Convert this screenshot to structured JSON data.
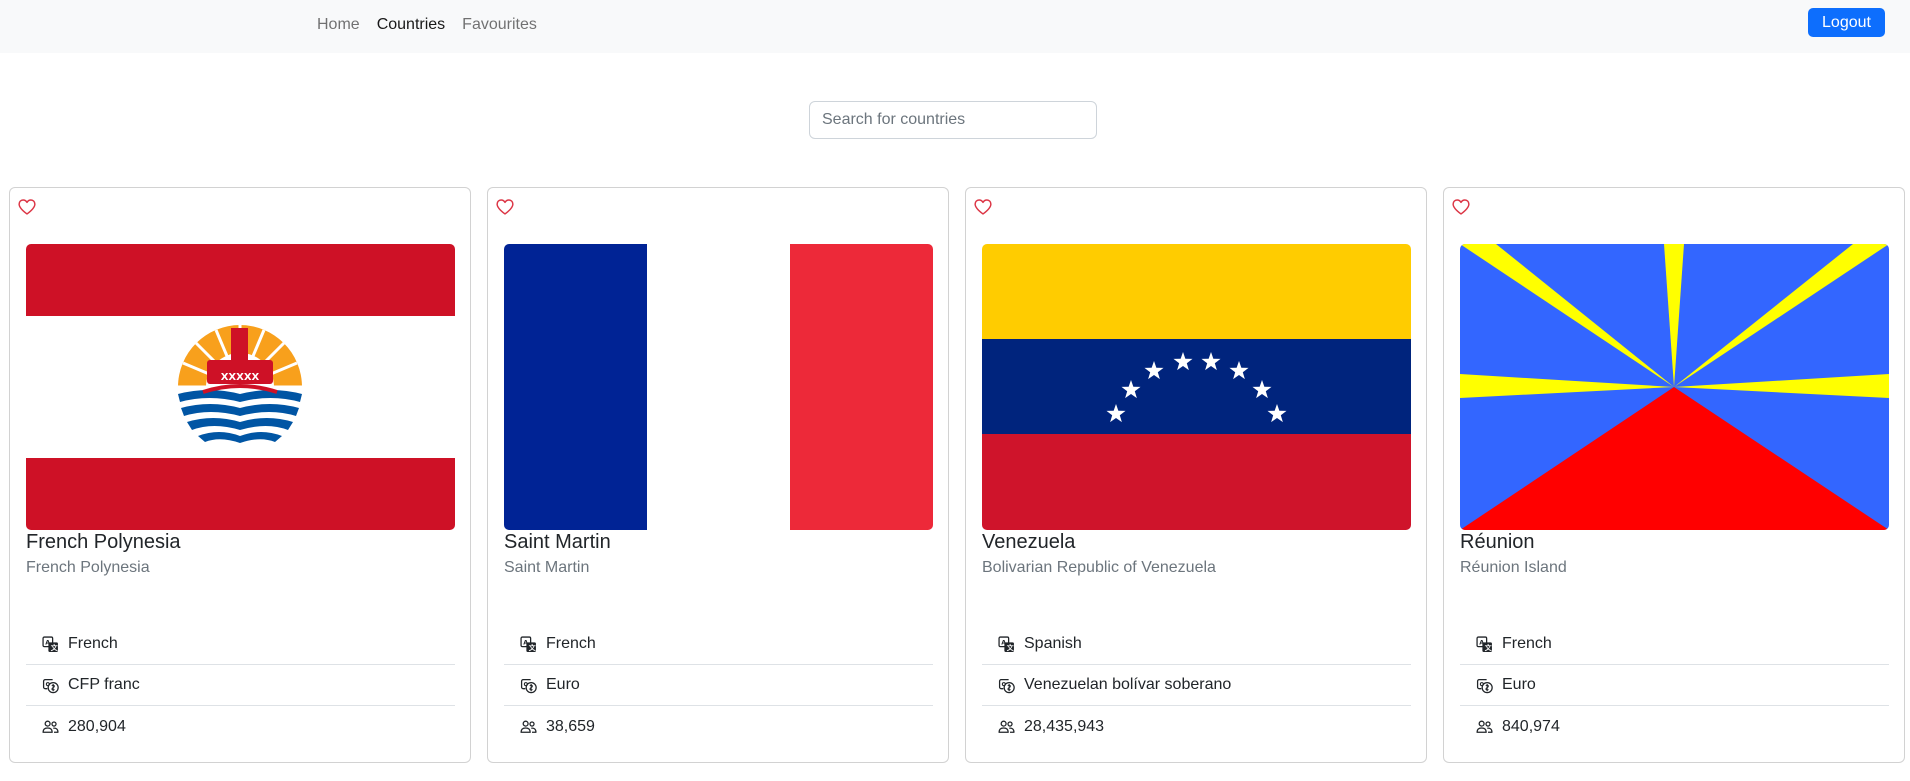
{
  "nav": {
    "links": [
      "Home",
      "Countries",
      "Favourites"
    ],
    "active": "Countries",
    "logout_label": "Logout"
  },
  "search": {
    "placeholder": "Search for countries",
    "value": ""
  },
  "countries": [
    {
      "name": "French Polynesia",
      "official": "French Polynesia",
      "language": "French",
      "currency": "CFP franc",
      "population": "280,904",
      "flag": "french-polynesia-flag",
      "favourite": false
    },
    {
      "name": "Saint Martin",
      "official": "Saint Martin",
      "language": "French",
      "currency": "Euro",
      "population": "38,659",
      "flag": "saint-martin-flag",
      "favourite": false
    },
    {
      "name": "Venezuela",
      "official": "Bolivarian Republic of Venezuela",
      "language": "Spanish",
      "currency": "Venezuelan bolívar soberano",
      "population": "28,435,943",
      "flag": "venezuela-flag",
      "favourite": false
    },
    {
      "name": "Réunion",
      "official": "Réunion Island",
      "language": "French",
      "currency": "Euro",
      "population": "840,974",
      "flag": "reunion-flag",
      "favourite": false
    }
  ],
  "colors": {
    "primary": "#0d6efd",
    "heart": "#dc3545",
    "navbar": "#f8f9fa"
  },
  "icons": {
    "favourite": "heart-icon",
    "language": "translate-icon",
    "currency": "currency-icon",
    "population": "people-icon"
  }
}
